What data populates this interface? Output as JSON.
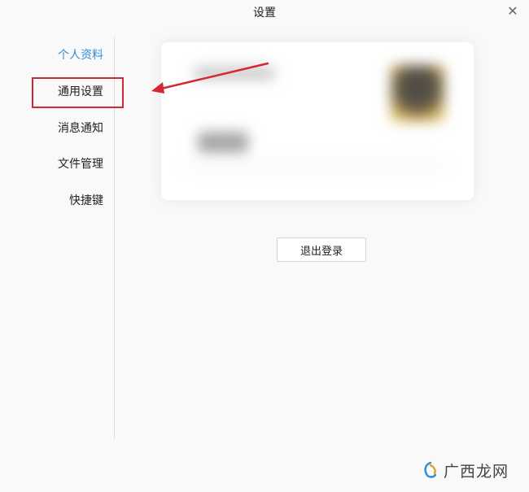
{
  "window": {
    "title": "设置",
    "close_icon": "close-icon"
  },
  "sidebar": {
    "items": [
      {
        "label": "个人资料",
        "active": true
      },
      {
        "label": "通用设置",
        "active": false
      },
      {
        "label": "消息通知",
        "active": false
      },
      {
        "label": "文件管理",
        "active": false
      },
      {
        "label": "快捷键",
        "active": false
      }
    ]
  },
  "main": {
    "logout_label": "退出登录"
  },
  "colors": {
    "accent": "#2f8fd3",
    "highlight": "#d6262f"
  },
  "watermark": {
    "text": "广西龙网"
  }
}
